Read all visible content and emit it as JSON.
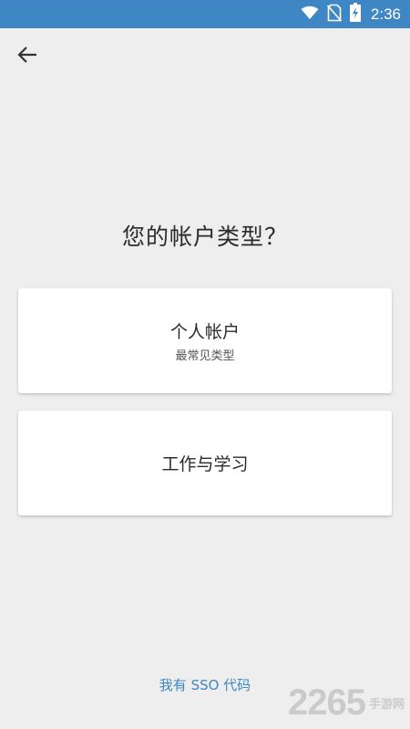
{
  "status_bar": {
    "time": "2:36",
    "icons": [
      "wifi-icon",
      "no-sim-icon",
      "battery-charging-icon"
    ],
    "color": "#3f86c4"
  },
  "nav": {
    "back_icon": "arrow-left-icon"
  },
  "title": "您的帐户类型？",
  "cards": [
    {
      "title": "个人帐户",
      "subtitle": "最常见类型"
    },
    {
      "title": "工作与学习"
    }
  ],
  "sso_link": "我有 SSO 代码",
  "watermark": {
    "number": "2265",
    "text": "手游网"
  },
  "colors": {
    "background": "#eeeeee",
    "accent": "#3f86c4",
    "card": "#ffffff"
  }
}
